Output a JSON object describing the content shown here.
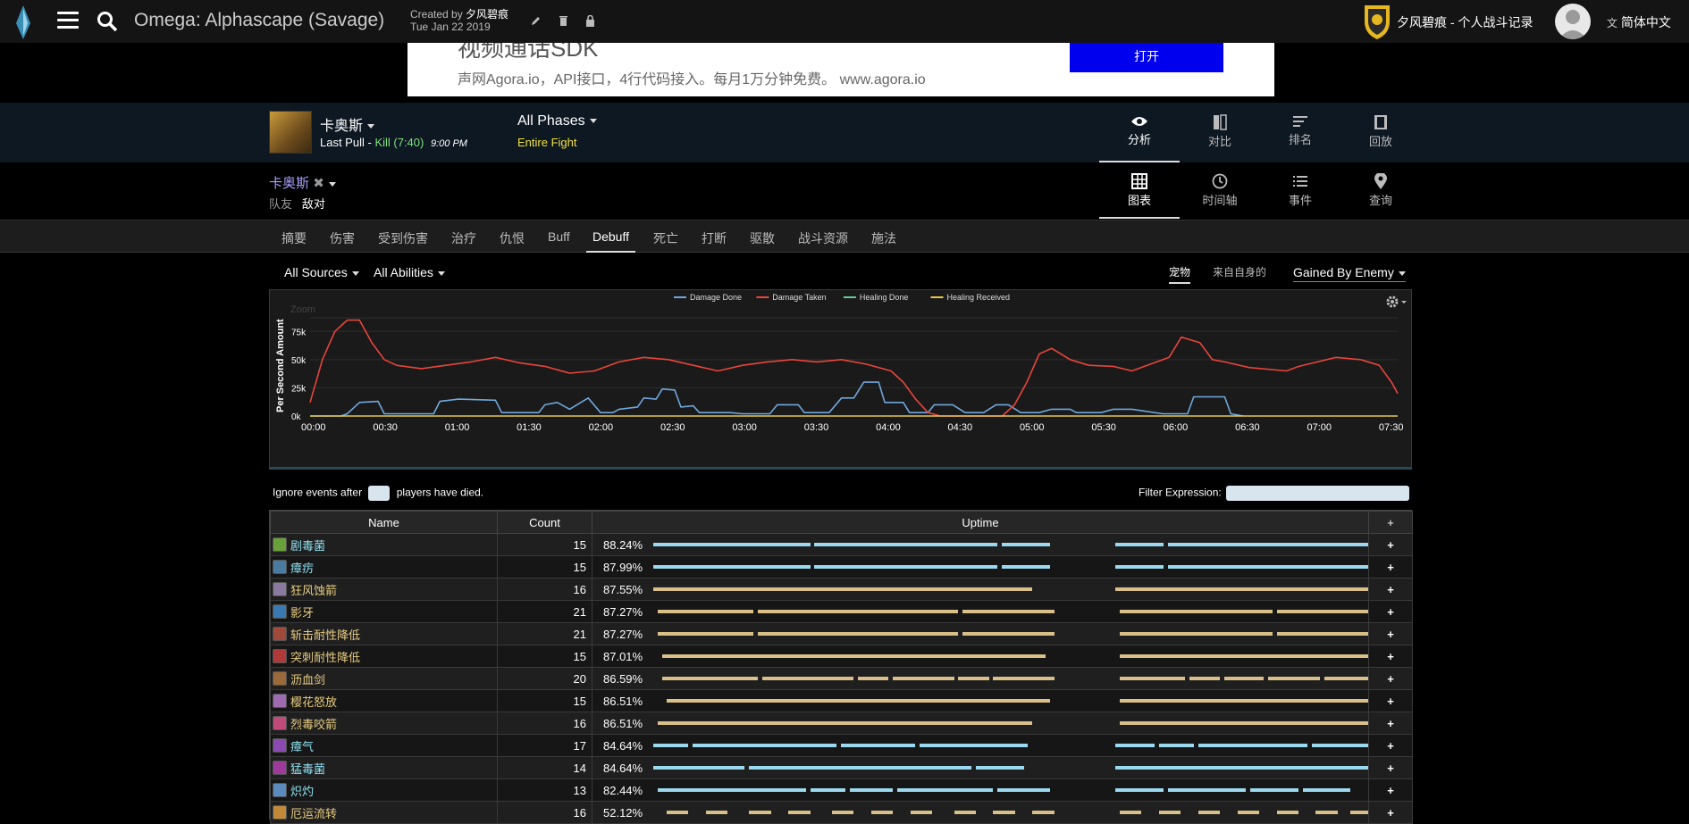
{
  "app": {
    "title": "Omega: Alphascape (Savage)",
    "created_by_label": "Created by",
    "created_by": "夕风碧痕",
    "date": "Tue Jan 22 2019",
    "guild": "夕风碧痕 - 个人战斗记录",
    "language": "简体中文"
  },
  "ad": {
    "headline": "视频通话SDK",
    "text": "声网Agora.io，API接口，4行代码接入。每月1万分钟免费。 www.agora.io",
    "button": "打开"
  },
  "boss": {
    "name": "卡奥斯",
    "pull_label": "Last Pull",
    "kill_text": "Kill (7:40)",
    "time": "9:00 PM",
    "phase": "All Phases",
    "phase_sub": "Entire Fight"
  },
  "nav_top": [
    {
      "label": "分析",
      "icon": "eye-icon",
      "active": true
    },
    {
      "label": "对比",
      "icon": "compare-icon",
      "active": false
    },
    {
      "label": "排名",
      "icon": "list-icon",
      "active": false
    },
    {
      "label": "回放",
      "icon": "film-icon",
      "active": false
    }
  ],
  "target": {
    "name": "卡奥斯",
    "friendly": "队友",
    "enemy": "敌对"
  },
  "nav_sub": [
    {
      "label": "图表",
      "icon": "table-icon",
      "active": true
    },
    {
      "label": "时间轴",
      "icon": "clock-icon",
      "active": false
    },
    {
      "label": "事件",
      "icon": "events-icon",
      "active": false
    },
    {
      "label": "查询",
      "icon": "map-pin-icon",
      "active": false
    }
  ],
  "tabs": [
    "摘要",
    "伤害",
    "受到伤害",
    "治疗",
    "仇恨",
    "Buff",
    "Debuff",
    "死亡",
    "打断",
    "驱散",
    "战斗资源",
    "施法"
  ],
  "active_tab": "Debuff",
  "filters": {
    "sources": "All Sources",
    "abilities": "All Abilities",
    "pet": "宠物",
    "self": "来自自身的",
    "gained": "Gained By Enemy"
  },
  "chart_data": {
    "type": "line",
    "ylabel": "Per Second Amount",
    "zoom_label": "Zoom",
    "y_ticks": [
      "0k",
      "25k",
      "50k",
      "75k"
    ],
    "ylim": [
      0,
      95000
    ],
    "x_ticks": [
      "00:00",
      "00:30",
      "01:00",
      "01:30",
      "02:00",
      "02:30",
      "03:00",
      "03:30",
      "04:00",
      "04:30",
      "05:00",
      "05:30",
      "06:00",
      "06:30",
      "07:00",
      "07:30"
    ],
    "xlim": [
      0,
      463
    ],
    "series": [
      {
        "name": "Damage Done",
        "color": "#6fa8dc",
        "values": [
          [
            0,
            0
          ],
          [
            25,
            0
          ],
          [
            30,
            2000
          ],
          [
            40,
            12000
          ],
          [
            55,
            13000
          ],
          [
            60,
            2000
          ],
          [
            100,
            2000
          ],
          [
            105,
            13000
          ],
          [
            120,
            15000
          ],
          [
            150,
            14000
          ],
          [
            155,
            3000
          ],
          [
            185,
            3000
          ],
          [
            190,
            10000
          ],
          [
            200,
            12000
          ],
          [
            210,
            6000
          ],
          [
            225,
            16000
          ],
          [
            235,
            3000
          ],
          [
            245,
            3000
          ],
          [
            250,
            6000
          ],
          [
            265,
            8000
          ],
          [
            270,
            16000
          ],
          [
            280,
            15000
          ],
          [
            285,
            24000
          ],
          [
            295,
            23000
          ],
          [
            300,
            8000
          ],
          [
            310,
            9000
          ],
          [
            315,
            3000
          ],
          [
            340,
            3000
          ],
          [
            350,
            2000
          ],
          [
            372,
            2000
          ],
          [
            378,
            10000
          ],
          [
            395,
            10000
          ],
          [
            400,
            3000
          ],
          [
            420,
            3000
          ],
          [
            430,
            16000
          ],
          [
            440,
            16000
          ],
          [
            448,
            30000
          ],
          [
            460,
            30000
          ],
          [
            465,
            12000
          ],
          [
            480,
            12000
          ],
          [
            485,
            3000
          ],
          [
            500,
            3000
          ],
          [
            505,
            10000
          ],
          [
            520,
            10000
          ],
          [
            530,
            3000
          ],
          [
            545,
            3000
          ],
          [
            555,
            10000
          ],
          [
            565,
            10000
          ],
          [
            575,
            3000
          ],
          [
            590,
            3000
          ],
          [
            600,
            6000
          ],
          [
            615,
            6000
          ],
          [
            620,
            3000
          ],
          [
            640,
            3000
          ],
          [
            650,
            6000
          ],
          [
            665,
            6000
          ],
          [
            690,
            2000
          ],
          [
            710,
            2000
          ],
          [
            715,
            17000
          ],
          [
            740,
            17000
          ],
          [
            745,
            2000
          ],
          [
            755,
            0
          ]
        ]
      },
      {
        "name": "Damage Taken",
        "color": "#e8453c",
        "values": [
          [
            0,
            12000
          ],
          [
            10,
            50000
          ],
          [
            20,
            75000
          ],
          [
            30,
            85000
          ],
          [
            40,
            85000
          ],
          [
            50,
            65000
          ],
          [
            60,
            50000
          ],
          [
            70,
            45000
          ],
          [
            90,
            42000
          ],
          [
            110,
            45000
          ],
          [
            130,
            48000
          ],
          [
            150,
            52000
          ],
          [
            170,
            47000
          ],
          [
            190,
            44000
          ],
          [
            210,
            38000
          ],
          [
            230,
            40000
          ],
          [
            250,
            48000
          ],
          [
            270,
            52000
          ],
          [
            290,
            50000
          ],
          [
            310,
            45000
          ],
          [
            330,
            40000
          ],
          [
            350,
            45000
          ],
          [
            370,
            48000
          ],
          [
            390,
            50000
          ],
          [
            410,
            48000
          ],
          [
            430,
            50000
          ],
          [
            450,
            46000
          ],
          [
            470,
            40000
          ],
          [
            480,
            30000
          ],
          [
            490,
            15000
          ],
          [
            500,
            3000
          ],
          [
            510,
            0
          ],
          [
            545,
            0
          ],
          [
            560,
            0
          ],
          [
            570,
            10000
          ],
          [
            580,
            30000
          ],
          [
            590,
            55000
          ],
          [
            600,
            60000
          ],
          [
            615,
            50000
          ],
          [
            630,
            45000
          ],
          [
            650,
            44000
          ],
          [
            665,
            40000
          ],
          [
            680,
            46000
          ],
          [
            695,
            52000
          ],
          [
            705,
            70000
          ],
          [
            720,
            65000
          ],
          [
            730,
            50000
          ],
          [
            740,
            48000
          ],
          [
            760,
            43000
          ],
          [
            790,
            40000
          ],
          [
            800,
            44000
          ],
          [
            815,
            48000
          ],
          [
            830,
            52000
          ],
          [
            850,
            50000
          ],
          [
            865,
            45000
          ],
          [
            875,
            30000
          ],
          [
            880,
            20000
          ]
        ]
      },
      {
        "name": "Healing Done",
        "color": "#66cc99",
        "values": []
      },
      {
        "name": "Healing Received",
        "color": "#e6c84c",
        "values": [
          [
            0,
            0
          ],
          [
            880,
            0
          ]
        ]
      }
    ]
  },
  "footer": {
    "ignore_label": "Ignore events after",
    "ignore_suffix": "players have died.",
    "filter_label": "Filter Expression:"
  },
  "table": {
    "headers": [
      "Name",
      "Count",
      "Uptime",
      "+"
    ],
    "rows": [
      {
        "name": "剧毒菌",
        "count": "15",
        "uptime": "88.24%",
        "color": "#9ad9f0",
        "icon": "#6aa03a",
        "segs": [
          [
            0,
            18
          ],
          [
            18.5,
            39.5
          ],
          [
            40,
            45.5
          ],
          [
            53,
            58.5
          ],
          [
            59,
            82
          ]
        ]
      },
      {
        "name": "瘴疠",
        "count": "15",
        "uptime": "87.99%",
        "color": "#9ad9f0",
        "icon": "#4a7aa0",
        "segs": [
          [
            0,
            18
          ],
          [
            18.5,
            39.5
          ],
          [
            40,
            45.5
          ],
          [
            53,
            58.5
          ],
          [
            59,
            82
          ]
        ]
      },
      {
        "name": "狂风蚀箭",
        "count": "16",
        "uptime": "87.55%",
        "color": "#d8c088",
        "icon": "#8a7aa0",
        "segs": [
          [
            0,
            43.5
          ],
          [
            53,
            82
          ]
        ]
      },
      {
        "name": "影牙",
        "count": "21",
        "uptime": "87.27%",
        "color": "#d8c088",
        "icon": "#3a7ab0",
        "segs": [
          [
            0.5,
            11.5
          ],
          [
            12,
            35
          ],
          [
            35.5,
            46
          ],
          [
            53.5,
            71
          ],
          [
            71.5,
            82
          ]
        ]
      },
      {
        "name": "斩击耐性降低",
        "count": "21",
        "uptime": "87.27%",
        "color": "#d8c088",
        "icon": "#a04a3a",
        "segs": [
          [
            0.5,
            11.5
          ],
          [
            12,
            35
          ],
          [
            35.5,
            46
          ],
          [
            53.5,
            71
          ],
          [
            71.5,
            82
          ]
        ]
      },
      {
        "name": "突刺耐性降低",
        "count": "15",
        "uptime": "87.01%",
        "color": "#d8c088",
        "icon": "#b03a3a",
        "segs": [
          [
            1,
            45
          ],
          [
            53.5,
            82
          ]
        ]
      },
      {
        "name": "沥血剑",
        "count": "20",
        "uptime": "86.59%",
        "color": "#d8c088",
        "icon": "#9a6a3a",
        "segs": [
          [
            1,
            12
          ],
          [
            12.5,
            23
          ],
          [
            23.5,
            27
          ],
          [
            27.5,
            34.5
          ],
          [
            35,
            38.5
          ],
          [
            39,
            46
          ],
          [
            53.5,
            61
          ],
          [
            61.5,
            65
          ],
          [
            65.5,
            70
          ],
          [
            70.5,
            76.5
          ],
          [
            77,
            82
          ]
        ]
      },
      {
        "name": "樱花怒放",
        "count": "15",
        "uptime": "86.51%",
        "color": "#d8c088",
        "icon": "#a06ab0",
        "segs": [
          [
            1.5,
            45.5
          ],
          [
            53.5,
            82
          ]
        ]
      },
      {
        "name": "烈毒咬箭",
        "count": "16",
        "uptime": "86.51%",
        "color": "#d8c088",
        "icon": "#c04a7a",
        "segs": [
          [
            0.5,
            43.5
          ],
          [
            53.5,
            82
          ]
        ]
      },
      {
        "name": "瘴气",
        "count": "17",
        "uptime": "84.64%",
        "color": "#9ad9f0",
        "icon": "#8a4ab0",
        "segs": [
          [
            0,
            4
          ],
          [
            4.5,
            21
          ],
          [
            21.5,
            30
          ],
          [
            30.5,
            43
          ],
          [
            53,
            57.5
          ],
          [
            58,
            62
          ],
          [
            62.5,
            75
          ],
          [
            75.5,
            82
          ]
        ]
      },
      {
        "name": "猛毒菌",
        "count": "14",
        "uptime": "84.64%",
        "color": "#9ad9f0",
        "icon": "#a03a9a",
        "segs": [
          [
            0,
            10.5
          ],
          [
            11,
            36.5
          ],
          [
            37,
            42.5
          ],
          [
            53,
            82
          ]
        ]
      },
      {
        "name": "炽灼",
        "count": "13",
        "uptime": "82.44%",
        "color": "#9ad9f0",
        "icon": "#5a8ac0",
        "segs": [
          [
            0.5,
            17.5
          ],
          [
            18,
            22
          ],
          [
            22.5,
            27.5
          ],
          [
            28,
            39
          ],
          [
            39.5,
            45.5
          ],
          [
            53,
            58.5
          ],
          [
            59,
            68
          ],
          [
            68.5,
            74
          ],
          [
            74.5,
            80
          ]
        ]
      },
      {
        "name": "厄运流转",
        "count": "16",
        "uptime": "52.12%",
        "color": "#d8c088",
        "icon": "#c08a3a",
        "segs": [
          [
            1.5,
            4
          ],
          [
            6,
            8.5
          ],
          [
            11,
            13.5
          ],
          [
            15.5,
            18
          ],
          [
            20.5,
            23
          ],
          [
            25,
            27.5
          ],
          [
            29.5,
            32
          ],
          [
            34.5,
            37
          ],
          [
            39,
            41.5
          ],
          [
            43.5,
            46
          ],
          [
            53.5,
            56
          ],
          [
            58,
            60.5
          ],
          [
            62.5,
            65
          ],
          [
            67,
            69.5
          ],
          [
            71.5,
            74
          ],
          [
            76,
            78.5
          ],
          [
            80,
            82
          ]
        ]
      }
    ]
  }
}
